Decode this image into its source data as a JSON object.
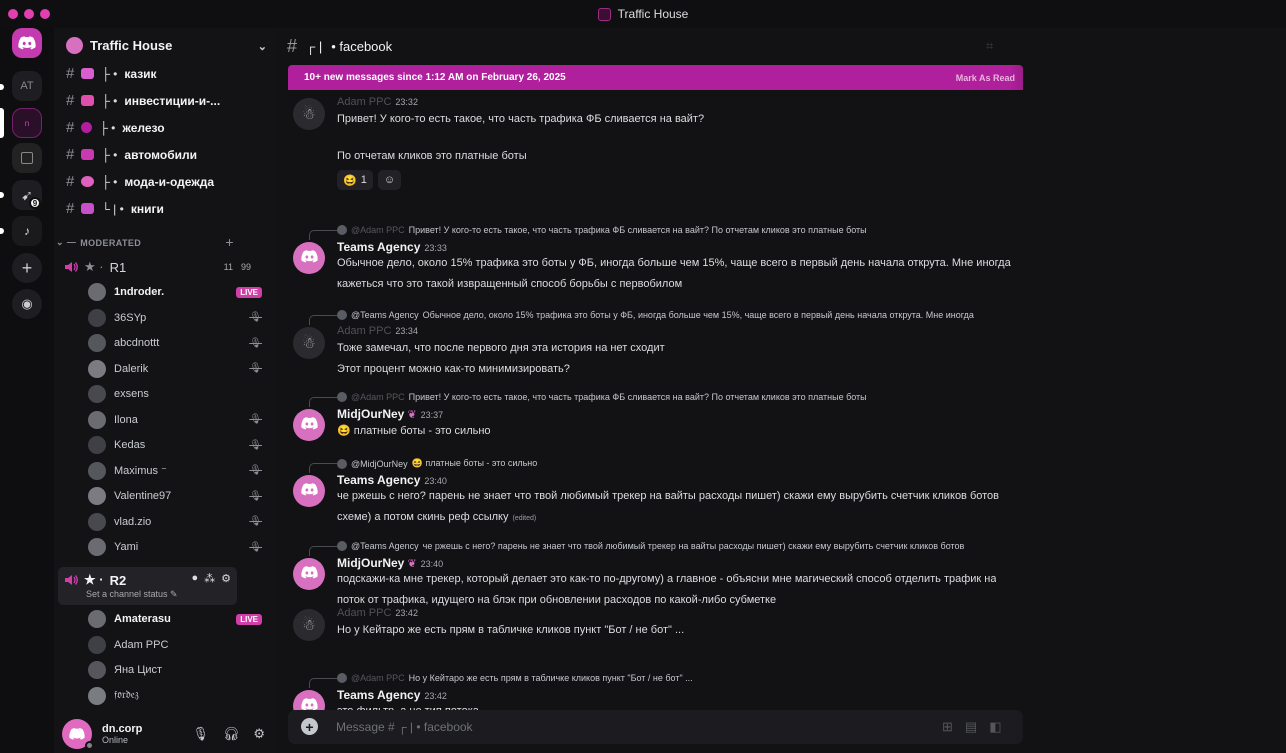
{
  "window": {
    "title": "Traffic House"
  },
  "rail": {
    "servers": [
      {
        "name": "home",
        "label": ""
      },
      {
        "name": "server-at",
        "label": "AT"
      },
      {
        "name": "server-traffic-house",
        "label": ""
      },
      {
        "name": "server-3",
        "label": ""
      },
      {
        "name": "server-4",
        "label": "",
        "badge": "9"
      },
      {
        "name": "server-5",
        "label": ""
      }
    ]
  },
  "server": {
    "name": "Traffic House"
  },
  "channels": [
    {
      "tree": "├ •",
      "name": "казик",
      "color": "#d95fd0"
    },
    {
      "tree": "├ •",
      "name": "инвестиции-и-...",
      "color": "#e04fae"
    },
    {
      "tree": "├ •",
      "name": "железо",
      "color": "#b01fa0"
    },
    {
      "tree": "├ •",
      "name": "автомобили",
      "color": "#c93ab0"
    },
    {
      "tree": "├ •",
      "name": "мода-и-одежда",
      "color": "#e060c0"
    },
    {
      "tree": "└ |  •",
      "name": "книги",
      "color": "#c850c8"
    }
  ],
  "category": {
    "label": "MODERATED"
  },
  "voice": {
    "r1": {
      "name": "R1",
      "count_a": "11",
      "count_b": "99"
    },
    "r1_members": [
      {
        "name": "1ndroder.",
        "state": "live"
      },
      {
        "name": "36SYp",
        "state": "muted"
      },
      {
        "name": "abcdnottt",
        "state": "muted"
      },
      {
        "name": "Dalerik",
        "state": "muted"
      },
      {
        "name": "exsens",
        "state": ""
      },
      {
        "name": "Ilona",
        "state": "muted"
      },
      {
        "name": "Kedas",
        "state": "muted"
      },
      {
        "name": "Maximus ⁻",
        "state": "muted"
      },
      {
        "name": "Valentine97",
        "state": "muted"
      },
      {
        "name": "vlad.zio",
        "state": "muted"
      },
      {
        "name": "Yami",
        "state": "muted"
      }
    ],
    "r2": {
      "name": "R2",
      "status": "Set a channel status ✎"
    },
    "r2_members": [
      {
        "name": "Amaterasu",
        "state": "live"
      },
      {
        "name": "Adam PPC",
        "state": ""
      },
      {
        "name": "Яна Цист",
        "state": ""
      },
      {
        "name": "𝔣𝔬𝔯𝔡𝔢𝔷",
        "state": ""
      }
    ]
  },
  "live_label": "LIVE",
  "user": {
    "name": "dn.corp",
    "status": "Online"
  },
  "channel_header": {
    "tree": "┌ |",
    "name": "• facebook"
  },
  "new_messages_bar": {
    "text": "10+ new messages since 1:12 AM on February 26, 2025",
    "mark": "Mark As Read"
  },
  "messages": [
    {
      "author": "Adam PPC",
      "time": "23:32",
      "dim": true,
      "lines": [
        "Привет! У кого-то есть такое, что часть трафика ФБ сливается на вайт?",
        "",
        "По отчетам кликов это платные боты"
      ]
    },
    {
      "reply_to": "@Adam PPC",
      "reply_text": "Привет! У кого-то есть такое, что часть трафика ФБ сливается на вайт?  По отчетам кликов это платные боты",
      "author": "Teams Agency",
      "time": "23:33",
      "lines": [
        "Обычное дело, около 15% трафика это боты у ФБ, иногда больше чем 15%, чаще всего в первый день начала открута. Мне иногда",
        "кажеться что это такой извращенный способ борьбы с первобилом"
      ]
    },
    {
      "reply_to": "@Teams Agency",
      "reply_text": "Обычное дело, около 15% трафика это боты у ФБ, иногда больше чем 15%, чаще всего в первый день начала открута. Мне иногда",
      "author": "Adam PPC",
      "time": "23:34",
      "dim": true,
      "lines": [
        "Тоже замечал, что после первого дня эта история на нет сходит",
        "Этот процент можно как-то минимизировать?"
      ]
    },
    {
      "reply_to": "@Adam PPC",
      "reply_text": "Привет! У кого-то есть такое, что часть трафика ФБ сливается на вайт?  По отчетам кликов это платные боты",
      "author": "MidjOurNey",
      "time": "23:37",
      "lines": [
        "😆 платные боты - это сильно"
      ]
    },
    {
      "reply_to": "@MidjOurNey",
      "reply_text": "😆 платные боты - это сильно",
      "author": "Teams Agency",
      "time": "23:40",
      "lines": [
        "че ржешь с него? парень не знает что твой любимый трекер на вайты расходы пишет) скажи ему вырубить счетчик кликов ботов",
        "схеме) а потом скинь реф ссылку"
      ],
      "edited": "(edited)"
    },
    {
      "reply_to": "@Teams Agency",
      "reply_text": "че ржешь с него? парень не знает что твой любимый трекер на вайты расходы пишет) скажи ему вырубить счетчик кликов ботов",
      "author": "MidjOurNey",
      "time": "23:40",
      "lines": [
        "подскажи-ка мне трекер, который делает это как-то по-другому) а главное - объясни мне магический способ отделить трафик на",
        "поток от трафика, идущего на блэк при обновлении расходов по какой-либо субметке"
      ]
    },
    {
      "author": "Adam PPC",
      "time": "23:42",
      "dim": true,
      "lines": [
        "Но у Кейтаро же есть прям в табличке кликов пункт \"Бот / не бот\" ..."
      ]
    },
    {
      "reply_to": "@Adam PPC",
      "reply_text": "Но у Кейтаро же есть прям в табличке кликов пункт \"Бот / не бот\" ...",
      "author": "Teams Agency",
      "time": "23:42",
      "lines": [
        "это фильтр, а не тип потока"
      ]
    }
  ],
  "reactions": [
    {
      "emoji": "😆",
      "count": "1"
    }
  ],
  "composer": {
    "placeholder": "Message # ┌ |  • facebook"
  },
  "colors": {
    "accent": "#b01f9c",
    "avatar": "#d870c0",
    "live": "#d03ea8"
  }
}
